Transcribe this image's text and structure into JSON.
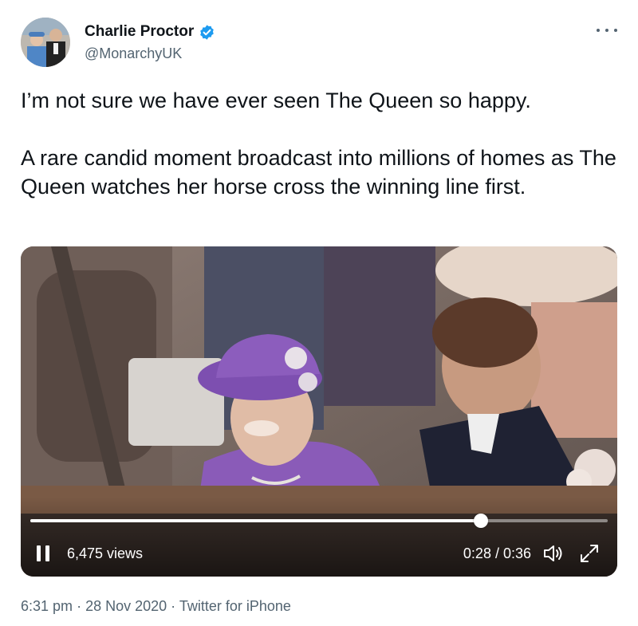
{
  "author": {
    "display_name": "Charlie Proctor",
    "handle": "@MonarchyUK",
    "verified": true
  },
  "tweet": {
    "paragraphs": [
      "I’m not sure we have ever seen The Queen so happy.",
      "A rare candid moment broadcast into millions of homes as The Queen watches her horse cross the winning line first."
    ]
  },
  "video": {
    "views": "6,475 views",
    "time": "0:28 / 0:36",
    "progress": 0.78,
    "state": "playing"
  },
  "meta": {
    "time": "6:31 pm",
    "separator": "·",
    "date": "28 Nov 2020",
    "source": "Twitter for iPhone"
  },
  "colors": {
    "text_primary": "#0f1419",
    "text_secondary": "#536471",
    "verified_blue": "#1d9bf0",
    "hat_purple": "#8a5bb8"
  },
  "icons": {
    "verified": "verified-badge-icon",
    "more": "more-options-icon",
    "pause": "pause-icon",
    "volume": "volume-icon",
    "fullscreen": "fullscreen-icon"
  }
}
